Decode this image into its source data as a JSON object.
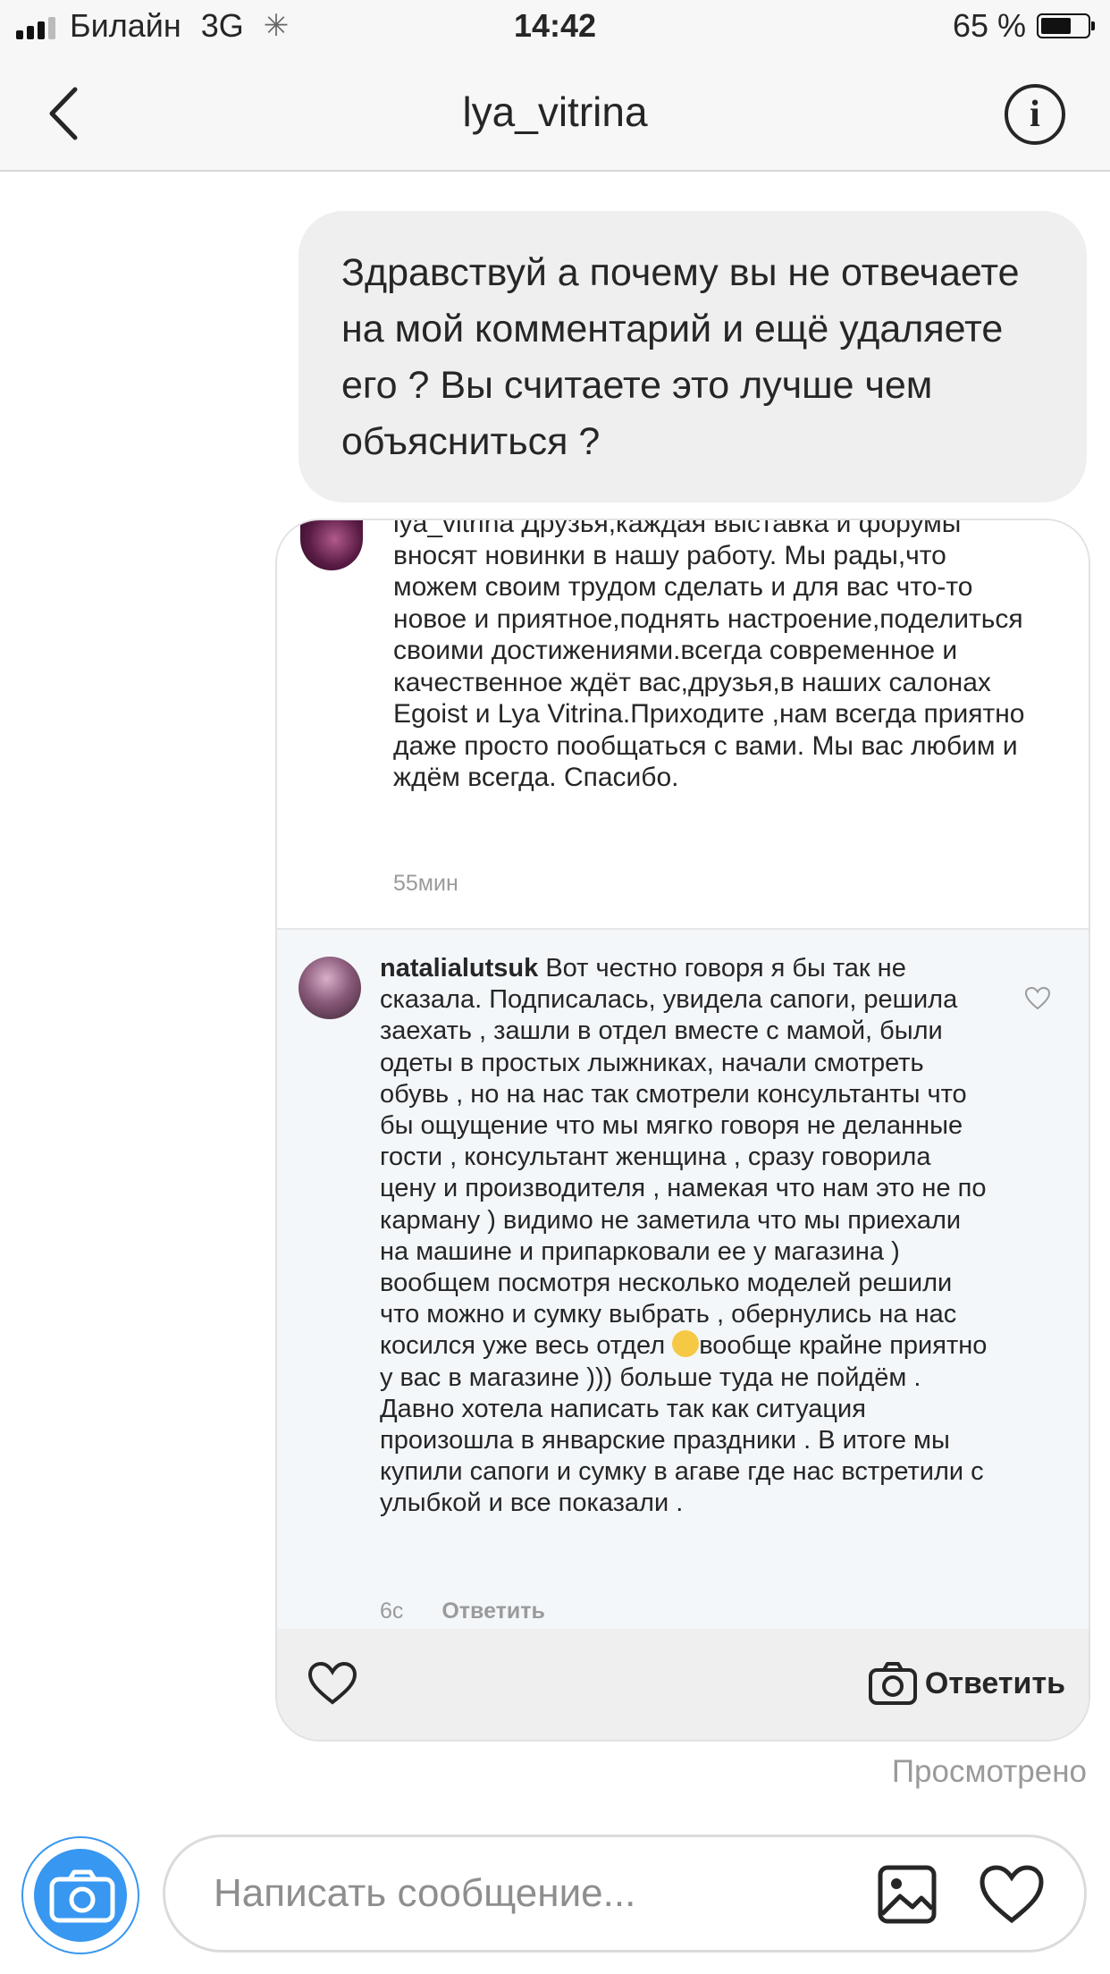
{
  "status_bar": {
    "carrier": "Билайн",
    "network": "3G",
    "time": "14:42",
    "battery": "65 %",
    "battery_level": 0.65
  },
  "header": {
    "title": "lya_vitrina",
    "info_symbol": "i"
  },
  "my_message": "Здравствуй а почему вы не отвечаете на мой комментарий и ещё удаляете его ? Вы считаете это лучше чем объясниться ?",
  "shared_post": {
    "comment1": {
      "username": "lya_vitrina",
      "text": "Друзья,каждая выставка и форумы вносят новинки в нашу работу. Мы рады,что можем своим трудом сделать и для вас что-то новое и приятное,поднять настроение,поделиться своими достижениями.всегда современное и качественное ждёт вас,друзья,в наших салонах Egoist и Lya Vitrina.Приходите ,нам всегда приятно  даже просто пообщаться с вами. Мы вас любим и ждём всегда. Спасибо.",
      "time": "55мин"
    },
    "comment2": {
      "username": "natalialutsuk",
      "text_part1": "Вот честно говоря я бы так не сказала. Подписалась, увидела сапоги, решила заехать , зашли в отдел вместе с мамой, были одеты в простых лыжниках, начали смотреть обувь , но на нас так смотрели консультанты что бы ощущение что мы мягко говоря не деланные гости , консультант женщина , сразу говорила цену и производителя , намекая что нам это не по карману ) видимо не заметила что мы приехали на машине и припарковали ее у магазина ) вообщем посмотря несколько моделей решили что можно и сумку выбрать , обернулись на нас косился уже весь отдел",
      "text_part2": "вообще крайне приятно у вас в магазине ))) больше туда не пойдём . Давно хотела написать так как ситуация произошла в январские праздники . В итоге мы купили сапоги и сумку в агаве где нас встретили с улыбкой и все показали .",
      "time": "6с",
      "reply_label": "Ответить"
    },
    "reply_button": "Ответить"
  },
  "seen_label": "Просмотрено",
  "composer": {
    "placeholder": "Написать сообщение..."
  },
  "icons": [
    "back-chevron-icon",
    "info-icon",
    "heart-icon",
    "camera-icon",
    "gallery-icon"
  ],
  "colors": {
    "accent": "#3897f0",
    "bubble": "#efefef",
    "text": "#262626",
    "muted": "#9a9a9a"
  }
}
